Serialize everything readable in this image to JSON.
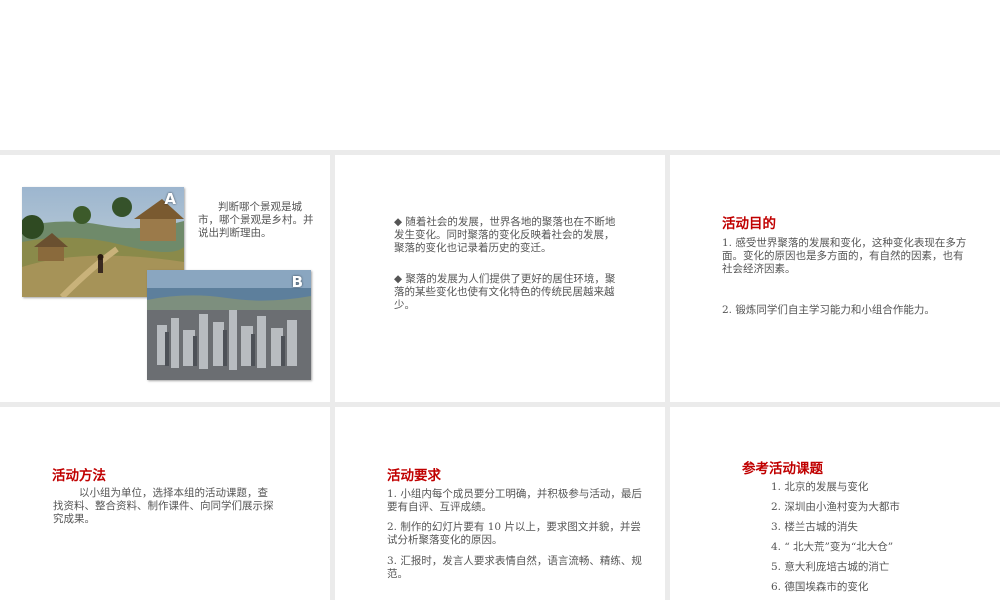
{
  "slide1": {
    "photo_a_label": "A",
    "photo_b_label": "B",
    "text": "判断哪个景观是城市，哪个景观是乡村。并说出判断理由。"
  },
  "slide2": {
    "p1": "◆ 随着社会的发展，世界各地的聚落也在不断地发生变化。同时聚落的变化反映着社会的发展，聚落的变化也记录着历史的变迁。",
    "p2": "◆ 聚落的发展为人们提供了更好的居住环境，聚落的某些变化也使有文化特色的传统民居越来越少。"
  },
  "slide3": {
    "heading": "活动目的",
    "p1": "1. 感受世界聚落的发展和变化，这种变化表现在多方面。变化的原因也是多方面的，有自然的因素，也有社会经济因素。",
    "p2": "2. 锻炼同学们自主学习能力和小组合作能力。"
  },
  "slide4": {
    "heading": "活动方法",
    "p": "以小组为单位，选择本组的活动课题，查找资料、整合资料、制作课件、向同学们展示探究成果。"
  },
  "slide5": {
    "heading": "活动要求",
    "p1": "1. 小组内每个成员要分工明确，并积极参与活动，最后要有自评、互评成绩。",
    "p2": "2. 制作的幻灯片要有 10 片以上，要求图文并貌，并尝试分析聚落变化的原因。",
    "p3": "3. 汇报时，发言人要求表情自然，语言流畅、精练、规范。"
  },
  "slide6": {
    "heading": "参考活动课题",
    "items": [
      "1. 北京的发展与变化",
      "2. 深圳由小渔村变为大都市",
      "3. 楼兰古城的消失",
      "4. “ 北大荒”变为“北大仓”",
      "5. 意大利庞培古城的消亡",
      "6. 德国埃森市的变化"
    ]
  },
  "colors": {
    "heading": "#c00000",
    "body_text": "#555555",
    "background": "#ebebeb"
  }
}
